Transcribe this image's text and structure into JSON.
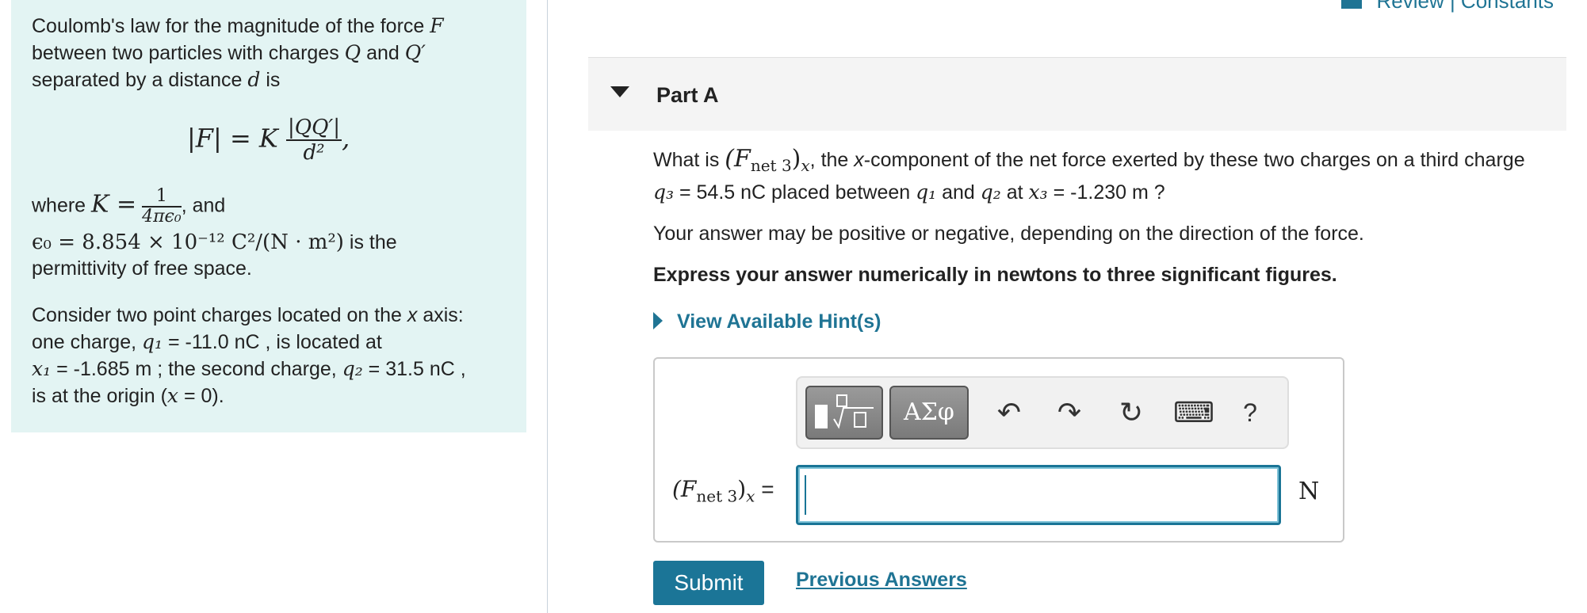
{
  "review": {
    "label": "Review | Constants"
  },
  "left": {
    "intro": [
      "Coulomb's law for the magnitude of the force ",
      " between two particles with charges ",
      " and ",
      " separated by a distance ",
      " is"
    ],
    "sym_F": "F",
    "sym_Q": "Q",
    "sym_Qp": "Q′",
    "sym_d": "d",
    "law_lhs": "|F| = K",
    "law_num": "|QQ′|",
    "law_den": "d²",
    "where": "where",
    "K_eq": "K =",
    "K_num": "1",
    "K_den": "4πϵ₀",
    "and": ", and",
    "epsilon": "ϵ₀ = 8.854 × 10⁻¹² C²/(N · m²)",
    "is_the": " is the",
    "permittivity": "permittivity of free space.",
    "consider_1": "Consider two point charges located on the ",
    "x": "x",
    "consider_2": " axis:",
    "q1_pre": "one charge, ",
    "q1_sym": "q₁",
    "q1_val": " = -11.0 nC , is located at",
    "x1_sym": "x₁",
    "x1_val": " = -1.685 m ; the second charge, ",
    "q2_sym": "q₂",
    "q2_val": " = 31.5 nC ,",
    "origin_1": "is at the origin (",
    "origin_2": " = 0)."
  },
  "part": {
    "title": "Part A"
  },
  "question": {
    "pre": "What is ",
    "fnet": "(F",
    "fnet_sub": "net 3",
    "fnet_close": ")",
    "fnet_x": "x",
    "mid": ", the ",
    "xcomp": "x",
    "rest": "-component of the net force exerted by these two charges on a third charge",
    "q3": "q₃",
    "q3_val": " = 54.5 nC placed between ",
    "q1": "q₁",
    "and": " and ",
    "q2": "q₂",
    "at": " at ",
    "x3": "x₃",
    "x3_val": " = -1.230 m ?"
  },
  "note": "Your answer may be positive or negative, depending on the direction of the force.",
  "instruction": "Express your answer numerically in newtons to three significant figures.",
  "hints": {
    "label": "View Available Hint(s)"
  },
  "toolbar": {
    "greek": "ΑΣφ",
    "undo": "↶",
    "redo": "↷",
    "reset": "↻",
    "keyboard": "⌨",
    "help": "?"
  },
  "answer": {
    "label_pre": "(F",
    "label_sub": "net 3",
    "label_post": ")",
    "label_x": "x",
    "label_eq": " =",
    "value": "",
    "unit": "N"
  },
  "buttons": {
    "submit": "Submit",
    "previous": "Previous Answers"
  }
}
